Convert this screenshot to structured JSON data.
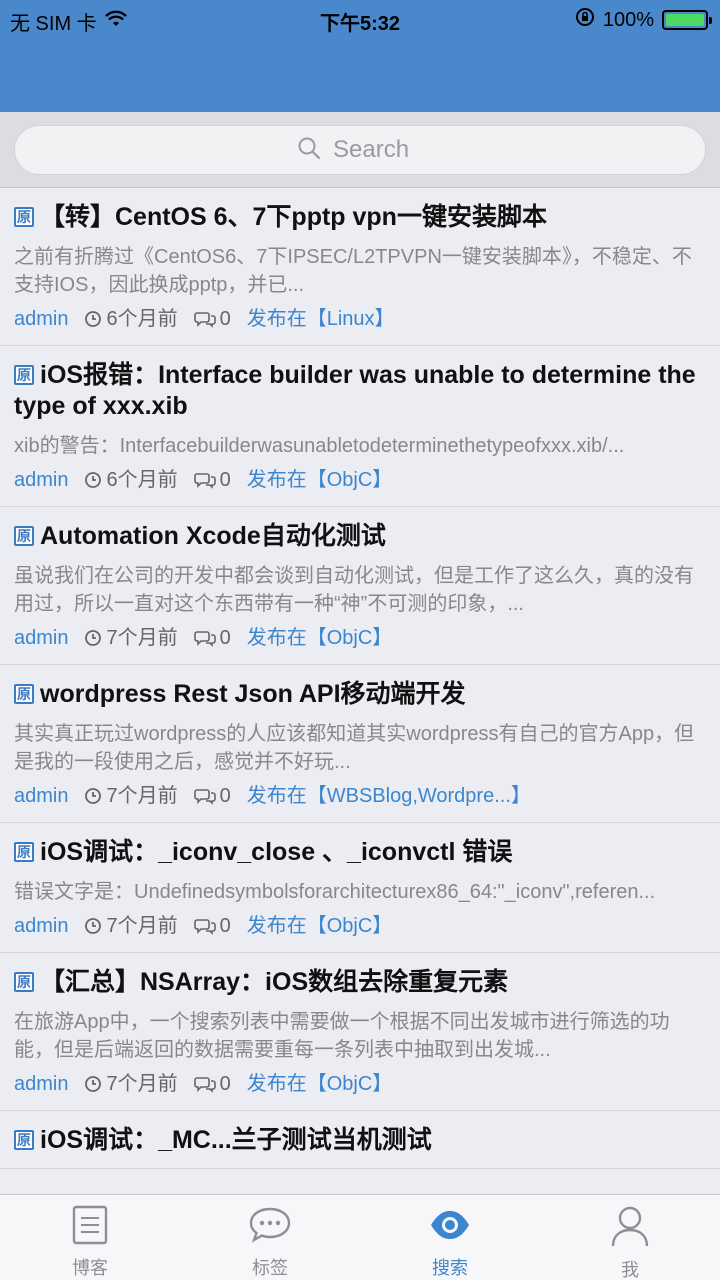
{
  "status_bar": {
    "carrier": "无 SIM 卡",
    "time": "下午5:32",
    "battery": "100%",
    "battery_level": 1.0
  },
  "search": {
    "placeholder": "Search",
    "icon": "search-icon"
  },
  "articles": [
    {
      "badge": "原",
      "title": "【转】CentOS 6、7下pptp vpn一键安装脚本",
      "excerpt": "之前有折腾过《CentOS6、7下IPSEC/L2TPVPN一键安装脚本》，不稳定、不支持IOS，因此换成pptp，并已...",
      "author": "admin",
      "time": "6个月前",
      "comments": "0",
      "category": "发布在【Linux】"
    },
    {
      "badge": "原",
      "title": "iOS报错：Interface builder was unable to determine the type of xxx.xib",
      "excerpt": "xib的警告：Interfacebuilderwasunabletodeterminethetypeofxxx.xib/...",
      "author": "admin",
      "time": "6个月前",
      "comments": "0",
      "category": "发布在【ObjC】"
    },
    {
      "badge": "原",
      "title": "Automation Xcode自动化测试",
      "excerpt": "虽说我们在公司的开发中都会谈到自动化测试，但是工作了这么久，真的没有用过，所以一直对这个东西带有一种“神”不可测的印象，...",
      "author": "admin",
      "time": "7个月前",
      "comments": "0",
      "category": "发布在【ObjC】"
    },
    {
      "badge": "原",
      "title": "wordpress Rest Json API移动端开发",
      "excerpt": "其实真正玩过wordpress的人应该都知道其实wordpress有自己的官方App，但是我的一段使用之后，感觉并不好玩...",
      "author": "admin",
      "time": "7个月前",
      "comments": "0",
      "category": "发布在【WBSBlog,Wordpre...】"
    },
    {
      "badge": "原",
      "title": "iOS调试：_iconv_close 、_iconvctl 错误",
      "excerpt": "错误文字是：Undefinedsymbolsforarchitecturex86_64:\"_iconv\",referen...",
      "author": "admin",
      "time": "7个月前",
      "comments": "0",
      "category": "发布在【ObjC】"
    },
    {
      "badge": "原",
      "title": "【汇总】NSArray：iOS数组去除重复元素",
      "excerpt": "在旅游App中，一个搜索列表中需要做一个根据不同出发城市进行筛选的功能，但是后端返回的数据需要重每一条列表中抽取到出发城...",
      "author": "admin",
      "time": "7个月前",
      "comments": "0",
      "category": "发布在【ObjC】"
    },
    {
      "badge": "原",
      "title": "iOS调试：_MC...兰子测试当机测试",
      "excerpt": "",
      "author": "",
      "time": "",
      "comments": "",
      "category": ""
    }
  ],
  "tabs": [
    {
      "label": "博客",
      "icon": "document-icon",
      "active": false
    },
    {
      "label": "标签",
      "icon": "chat-bubble-icon",
      "active": false
    },
    {
      "label": "搜索",
      "icon": "eye-icon",
      "active": true
    },
    {
      "label": "我",
      "icon": "person-icon",
      "active": false
    }
  ],
  "colors": {
    "header": "#4a88cc",
    "accent": "#3b86cf",
    "battery_fill": "#4cd964"
  }
}
